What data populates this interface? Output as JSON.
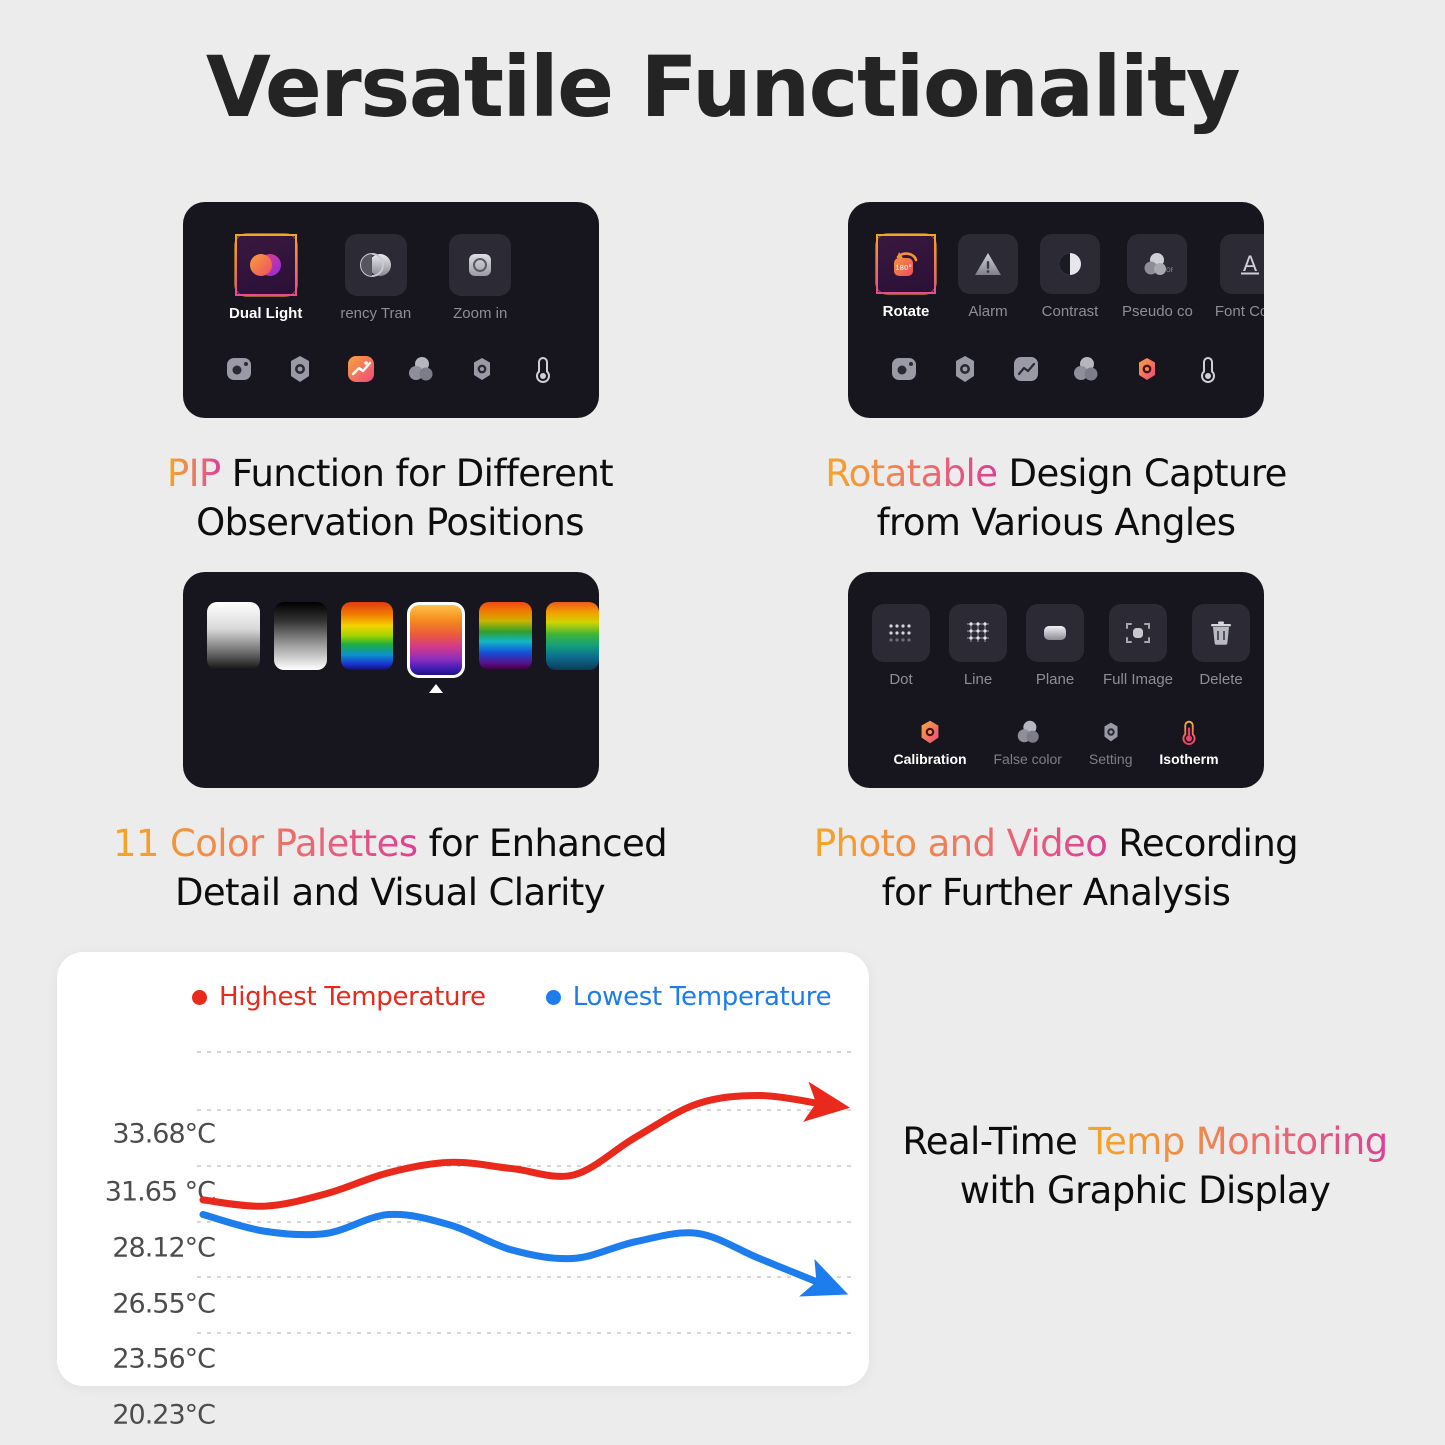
{
  "header": {
    "title": "Versatile Functionality"
  },
  "colors": {
    "background": "#ececec",
    "panel_bg": "#17161f",
    "accent_orange": "#f5a623",
    "accent_pink": "#dd3f93",
    "highest_temp": "#e8291c",
    "lowest_temp": "#1d7ded",
    "card_bg": "#ffffff"
  },
  "panels": [
    {
      "id": "pip-panel",
      "tiles": [
        {
          "label": "Dual Light",
          "icon": "dual-light-icon",
          "selected": true
        },
        {
          "label": "rency  Tran",
          "icon": "transparency-icon",
          "selected": false
        },
        {
          "label": "Zoom in",
          "icon": "zoom-in-icon",
          "selected": false
        }
      ],
      "toolbar": [
        {
          "icon": "camera-icon",
          "active": false
        },
        {
          "icon": "calibration-icon",
          "active": false
        },
        {
          "icon": "chart-icon",
          "active": true
        },
        {
          "icon": "false-color-icon",
          "active": false
        },
        {
          "icon": "setting-icon",
          "active": false
        },
        {
          "icon": "isotherm-icon",
          "active": false
        }
      ],
      "caption": {
        "highlight": "PIP",
        "rest": " Function for Different",
        "line2": "Observation Positions"
      }
    },
    {
      "id": "rotate-panel",
      "tiles": [
        {
          "label": "Rotate",
          "icon": "rotate-180-icon",
          "selected": true
        },
        {
          "label": "Alarm",
          "icon": "alarm-icon",
          "selected": false
        },
        {
          "label": "Contrast",
          "icon": "contrast-icon",
          "selected": false
        },
        {
          "label": "Pseudo co",
          "icon": "pseudo-color-icon",
          "selected": false
        },
        {
          "label": "Font Color",
          "icon": "font-color-icon",
          "selected": false
        }
      ],
      "toolbar": [
        {
          "icon": "camera-icon",
          "active": false
        },
        {
          "icon": "calibration-icon",
          "active": false
        },
        {
          "icon": "chart-icon",
          "active": false
        },
        {
          "icon": "false-color-icon",
          "active": false
        },
        {
          "icon": "setting-icon",
          "active": true
        },
        {
          "icon": "isotherm-icon",
          "active": false
        }
      ],
      "caption": {
        "highlight": "Rotatable",
        "rest": " Design Capture",
        "line2": "from Various Angles"
      }
    },
    {
      "id": "palette-panel",
      "palettes": [
        {
          "name": "white-hot",
          "selected": false
        },
        {
          "name": "black-hot",
          "selected": false
        },
        {
          "name": "rainbow",
          "selected": false
        },
        {
          "name": "iron",
          "selected": true
        },
        {
          "name": "rainbow-hc",
          "selected": false
        },
        {
          "name": "rainbow-2",
          "selected": false
        }
      ],
      "toolbar": [
        {
          "icon": "camera-icon",
          "active": false
        },
        {
          "icon": "calibration-icon",
          "active": false
        },
        {
          "icon": "chart-icon",
          "active": false
        },
        {
          "icon": "false-color-icon",
          "active": true
        },
        {
          "icon": "setting-icon",
          "active": false
        },
        {
          "icon": "isotherm-icon",
          "active": false
        }
      ],
      "caption": {
        "highlight": "11 Color Palettes",
        "rest": " for Enhanced",
        "line2": "Detail and Visual Clarity"
      }
    },
    {
      "id": "recording-panel",
      "tiles": [
        {
          "label": "Dot",
          "icon": "dot-icon",
          "selected": false
        },
        {
          "label": "Line",
          "icon": "line-icon",
          "selected": false
        },
        {
          "label": "Plane",
          "icon": "plane-icon",
          "selected": false
        },
        {
          "label": "Full Image",
          "icon": "full-image-icon",
          "selected": false
        },
        {
          "label": "Delete",
          "icon": "delete-icon",
          "selected": false
        }
      ],
      "toolbar": [
        {
          "label": "Calibration",
          "icon": "calibration-icon",
          "active": true
        },
        {
          "label": "False color",
          "icon": "false-color-icon",
          "active": false
        },
        {
          "label": "Setting",
          "icon": "setting-icon",
          "active": false
        },
        {
          "label": "Isotherm",
          "icon": "isotherm-icon",
          "active": true
        }
      ],
      "caption": {
        "highlight": "Photo and Video",
        "rest": " Recording",
        "line2": "for Further Analysis"
      }
    }
  ],
  "chart_side_caption": {
    "pre": "Real-Time ",
    "highlight": "Temp Monitoring",
    "line2": "with Graphic Display"
  },
  "chart_data": {
    "type": "line",
    "title": "",
    "xlabel": "",
    "ylabel": "",
    "grid": true,
    "legend_position": "top",
    "yticks": [
      "20.23°C",
      "23.56°C",
      "26.55°C",
      "28.12°C",
      "31.65 °C",
      "33.68°C"
    ],
    "ylim": [
      19.0,
      34.8
    ],
    "series": [
      {
        "name": "Highest Temperature",
        "color": "#e8291c",
        "x": [
          0,
          1,
          2,
          3,
          4,
          5,
          6,
          7,
          8,
          9,
          10
        ],
        "values": [
          26.6,
          26.3,
          26.9,
          27.9,
          28.4,
          28.1,
          27.8,
          29.6,
          31.2,
          31.6,
          31.2
        ]
      },
      {
        "name": "Lowest Temperature",
        "color": "#1d7ded",
        "x": [
          0,
          1,
          2,
          3,
          4,
          5,
          6,
          7,
          8,
          9,
          10
        ],
        "values": [
          25.9,
          25.1,
          25.0,
          25.9,
          25.4,
          24.2,
          23.8,
          24.6,
          25.0,
          23.8,
          22.6
        ]
      }
    ]
  }
}
